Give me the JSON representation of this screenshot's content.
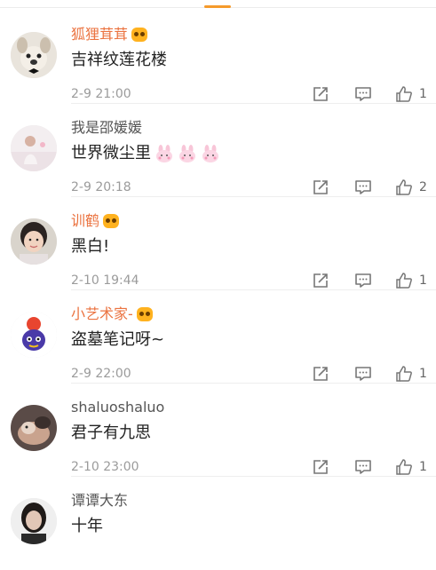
{
  "comments": [
    {
      "username": "狐狸茸茸",
      "name_color": "orange",
      "vip": true,
      "text": "吉祥纹莲花楼",
      "emoji_count": 0,
      "time": "2-9 21:00",
      "likes": "1"
    },
    {
      "username": "我是邵媛媛",
      "name_color": "gray",
      "vip": false,
      "text": "世界微尘里",
      "emoji_count": 3,
      "time": "2-9 20:18",
      "likes": "2"
    },
    {
      "username": "训鹤",
      "name_color": "orange",
      "vip": true,
      "text": "黑白!",
      "emoji_count": 0,
      "time": "2-10 19:44",
      "likes": "1"
    },
    {
      "username": "小艺术家-",
      "name_color": "orange",
      "vip": true,
      "text": "盗墓笔记呀~",
      "emoji_count": 0,
      "time": "2-9 22:00",
      "likes": "1"
    },
    {
      "username": "shaluoshaluo",
      "name_color": "gray",
      "vip": false,
      "text": "君子有九思",
      "emoji_count": 0,
      "time": "2-10 23:00",
      "likes": "1"
    },
    {
      "username": "谭谭大东",
      "name_color": "gray",
      "vip": false,
      "text": "十年",
      "emoji_count": 0,
      "time": "",
      "likes": ""
    }
  ],
  "icons": {
    "share": "share-icon",
    "reply": "comment-icon",
    "like": "thumbs-up-icon",
    "badge": "vip-badge-icon",
    "emoji": "pink-bunny-emoji"
  },
  "colors": {
    "accent": "#f59a2b",
    "orange_name": "#eb7340",
    "gray_name": "#555555",
    "text": "#222222",
    "meta": "#9b9b9b"
  }
}
